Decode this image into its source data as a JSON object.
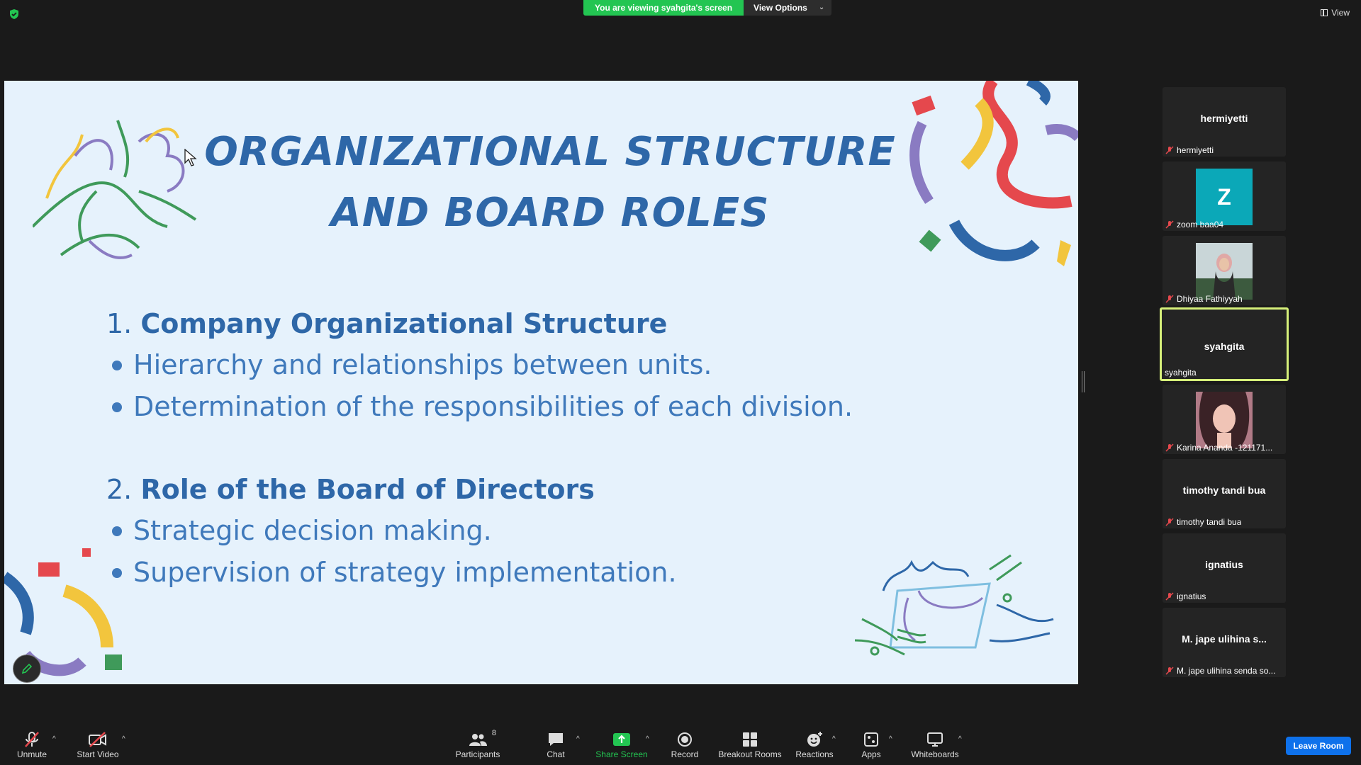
{
  "top_bar": {
    "banner_text": "You are viewing syahgita's screen",
    "view_options_label": "View Options",
    "view_label": "View"
  },
  "slide": {
    "title_line1": "ORGANIZATIONAL STRUCTURE",
    "title_line2": "AND BOARD ROLES",
    "section1": {
      "number": "1.",
      "heading": "Company Organizational Structure"
    },
    "section1_bullets": [
      "Hierarchy and relationships between units.",
      "Determination of the responsibilities of each division."
    ],
    "section2": {
      "number": "2.",
      "heading": "Role of the Board of Directors"
    },
    "section2_bullets": [
      "Strategic decision making.",
      "Supervision of strategy implementation."
    ]
  },
  "gallery": {
    "tiles": [
      {
        "display_name": "hermiyetti",
        "label": "hermiyetti"
      },
      {
        "avatar_letter": "Z",
        "label": "zoom baa04"
      },
      {
        "label": "Dhiyaa Fathiyyah"
      },
      {
        "display_name": "syahgita",
        "label": "syahgita"
      },
      {
        "label": "Karina Ananda -121171..."
      },
      {
        "display_name": "timothy tandi bua",
        "label": "timothy tandi bua"
      },
      {
        "display_name": "ignatius",
        "label": "ignatius"
      },
      {
        "display_name": "M. jape ulihina s...",
        "label": "M. jape ulihina senda so..."
      }
    ]
  },
  "toolbar": {
    "unmute": "Unmute",
    "start_video": "Start Video",
    "participants": "Participants",
    "participants_count": "8",
    "chat": "Chat",
    "share_screen": "Share Screen",
    "record": "Record",
    "breakout_rooms": "Breakout Rooms",
    "reactions": "Reactions",
    "apps": "Apps",
    "whiteboards": "Whiteboards",
    "leave_room": "Leave Room"
  },
  "colors": {
    "banner_green": "#23c552",
    "slide_bg": "#e6f2fc",
    "slide_title": "#2e67a8",
    "active_speaker_border": "#d6f07a",
    "leave_blue": "#0e71eb",
    "avatar_teal": "#0ba8b8"
  }
}
